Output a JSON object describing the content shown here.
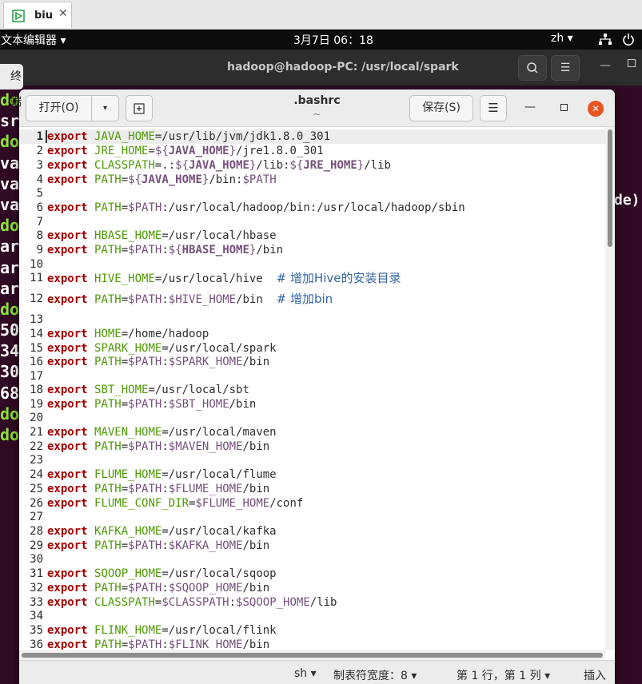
{
  "browser_tab": {
    "label": "biu",
    "close": "✕"
  },
  "topbar": {
    "app": "文本编辑器 ▾",
    "clock": "3月7日 06：18",
    "lang": "zh ▾"
  },
  "terminal": {
    "title": "hadoop@hadoop-PC: /usr/local/spark",
    "tab_fragment": "终端",
    "visible_fragments": [
      {
        "text": "do",
        "color": "green"
      },
      {
        "text": "sr",
        "color": "white"
      },
      {
        "text": "do",
        "color": "green"
      },
      {
        "text": "va",
        "color": "white"
      },
      {
        "text": "va",
        "color": "white"
      },
      {
        "text": "va",
        "color": "white"
      },
      {
        "text": "do",
        "color": "green"
      },
      {
        "text": "ar",
        "color": "white"
      },
      {
        "text": "ar",
        "color": "white"
      },
      {
        "text": "ar",
        "color": "white"
      },
      {
        "text": "do",
        "color": "green"
      },
      {
        "text": "50",
        "color": "white"
      },
      {
        "text": "34",
        "color": "white"
      },
      {
        "text": "30",
        "color": "white"
      },
      {
        "text": "68",
        "color": "white"
      },
      {
        "text": "do",
        "color": "green"
      },
      {
        "text": "do",
        "color": "green"
      }
    ],
    "right_fragment": "de)"
  },
  "gedit": {
    "open_label": "打开(O)",
    "open_arrow": "▾",
    "newtab_label": "⊞",
    "title": ".bashrc",
    "subtitle": "~",
    "save_label": "保存(S)",
    "menu_label": "☰",
    "min_label": "—",
    "close_label": "✕",
    "current_line": 1,
    "lines": [
      [
        {
          "c": "kw",
          "t": "export"
        },
        {
          "c": "p",
          "t": " "
        },
        {
          "c": "var",
          "t": "JAVA_HOME"
        },
        {
          "c": "p",
          "t": "=/usr/lib/jvm/jdk1.8.0_301"
        }
      ],
      [
        {
          "c": "kw",
          "t": "export"
        },
        {
          "c": "p",
          "t": " "
        },
        {
          "c": "var",
          "t": "JRE_HOME"
        },
        {
          "c": "p",
          "t": "="
        },
        {
          "c": "dollar",
          "t": "${"
        },
        {
          "c": "sub",
          "t": "JAVA_HOME"
        },
        {
          "c": "dollar",
          "t": "}"
        },
        {
          "c": "p",
          "t": "/jre1.8.0_301"
        }
      ],
      [
        {
          "c": "kw",
          "t": "export"
        },
        {
          "c": "p",
          "t": " "
        },
        {
          "c": "var",
          "t": "CLASSPATH"
        },
        {
          "c": "p",
          "t": "=.:"
        },
        {
          "c": "dollar",
          "t": "${"
        },
        {
          "c": "sub",
          "t": "JAVA_HOME"
        },
        {
          "c": "dollar",
          "t": "}"
        },
        {
          "c": "p",
          "t": "/lib:"
        },
        {
          "c": "dollar",
          "t": "${"
        },
        {
          "c": "sub",
          "t": "JRE_HOME"
        },
        {
          "c": "dollar",
          "t": "}"
        },
        {
          "c": "p",
          "t": "/lib"
        }
      ],
      [
        {
          "c": "kw",
          "t": "export"
        },
        {
          "c": "p",
          "t": " "
        },
        {
          "c": "var",
          "t": "PATH"
        },
        {
          "c": "p",
          "t": "="
        },
        {
          "c": "dollar",
          "t": "${"
        },
        {
          "c": "sub",
          "t": "JAVA_HOME"
        },
        {
          "c": "dollar",
          "t": "}"
        },
        {
          "c": "p",
          "t": "/bin:"
        },
        {
          "c": "dollar",
          "t": "$PATH"
        }
      ],
      [],
      [
        {
          "c": "kw",
          "t": "export"
        },
        {
          "c": "p",
          "t": " "
        },
        {
          "c": "var",
          "t": "PATH"
        },
        {
          "c": "p",
          "t": "="
        },
        {
          "c": "dollar",
          "t": "$PATH"
        },
        {
          "c": "p",
          "t": ":/usr/local/hadoop/bin:/usr/local/hadoop/sbin"
        }
      ],
      [],
      [
        {
          "c": "kw",
          "t": "export"
        },
        {
          "c": "p",
          "t": " "
        },
        {
          "c": "var",
          "t": "HBASE_HOME"
        },
        {
          "c": "p",
          "t": "=/usr/local/hbase"
        }
      ],
      [
        {
          "c": "kw",
          "t": "export"
        },
        {
          "c": "p",
          "t": " "
        },
        {
          "c": "var",
          "t": "PATH"
        },
        {
          "c": "p",
          "t": "="
        },
        {
          "c": "dollar",
          "t": "$PATH"
        },
        {
          "c": "p",
          "t": ":"
        },
        {
          "c": "dollar",
          "t": "${"
        },
        {
          "c": "sub",
          "t": "HBASE_HOME"
        },
        {
          "c": "dollar",
          "t": "}"
        },
        {
          "c": "p",
          "t": "/bin"
        }
      ],
      [],
      [
        {
          "c": "kw",
          "t": "export"
        },
        {
          "c": "p",
          "t": " "
        },
        {
          "c": "var",
          "t": "HIVE_HOME"
        },
        {
          "c": "p",
          "t": "=/usr/local/hive  "
        },
        {
          "c": "cmt",
          "t": "# 增加Hive的安装目录"
        }
      ],
      [
        {
          "c": "kw",
          "t": "export"
        },
        {
          "c": "p",
          "t": " "
        },
        {
          "c": "var",
          "t": "PATH"
        },
        {
          "c": "p",
          "t": "="
        },
        {
          "c": "dollar",
          "t": "$PATH"
        },
        {
          "c": "p",
          "t": ":"
        },
        {
          "c": "dollar",
          "t": "$HIVE_HOME"
        },
        {
          "c": "p",
          "t": "/bin  "
        },
        {
          "c": "cmt",
          "t": "# 增加bin"
        }
      ],
      [],
      [
        {
          "c": "kw",
          "t": "export"
        },
        {
          "c": "p",
          "t": " "
        },
        {
          "c": "var",
          "t": "HOME"
        },
        {
          "c": "p",
          "t": "=/home/hadoop"
        }
      ],
      [
        {
          "c": "kw",
          "t": "export"
        },
        {
          "c": "p",
          "t": " "
        },
        {
          "c": "var",
          "t": "SPARK_HOME"
        },
        {
          "c": "p",
          "t": "=/usr/local/spark"
        }
      ],
      [
        {
          "c": "kw",
          "t": "export"
        },
        {
          "c": "p",
          "t": " "
        },
        {
          "c": "var",
          "t": "PATH"
        },
        {
          "c": "p",
          "t": "="
        },
        {
          "c": "dollar",
          "t": "$PATH"
        },
        {
          "c": "p",
          "t": ":"
        },
        {
          "c": "dollar",
          "t": "$SPARK_HOME"
        },
        {
          "c": "p",
          "t": "/bin"
        }
      ],
      [],
      [
        {
          "c": "kw",
          "t": "export"
        },
        {
          "c": "p",
          "t": " "
        },
        {
          "c": "var",
          "t": "SBT_HOME"
        },
        {
          "c": "p",
          "t": "=/usr/local/sbt"
        }
      ],
      [
        {
          "c": "kw",
          "t": "export"
        },
        {
          "c": "p",
          "t": " "
        },
        {
          "c": "var",
          "t": "PATH"
        },
        {
          "c": "p",
          "t": "="
        },
        {
          "c": "dollar",
          "t": "$PATH"
        },
        {
          "c": "p",
          "t": ":"
        },
        {
          "c": "dollar",
          "t": "$SBT_HOME"
        },
        {
          "c": "p",
          "t": "/bin"
        }
      ],
      [],
      [
        {
          "c": "kw",
          "t": "export"
        },
        {
          "c": "p",
          "t": " "
        },
        {
          "c": "var",
          "t": "MAVEN_HOME"
        },
        {
          "c": "p",
          "t": "=/usr/local/maven"
        }
      ],
      [
        {
          "c": "kw",
          "t": "export"
        },
        {
          "c": "p",
          "t": " "
        },
        {
          "c": "var",
          "t": "PATH"
        },
        {
          "c": "p",
          "t": "="
        },
        {
          "c": "dollar",
          "t": "$PATH"
        },
        {
          "c": "p",
          "t": ":"
        },
        {
          "c": "dollar",
          "t": "$MAVEN_HOME"
        },
        {
          "c": "p",
          "t": "/bin"
        }
      ],
      [],
      [
        {
          "c": "kw",
          "t": "export"
        },
        {
          "c": "p",
          "t": " "
        },
        {
          "c": "var",
          "t": "FLUME_HOME"
        },
        {
          "c": "p",
          "t": "=/usr/local/flume"
        }
      ],
      [
        {
          "c": "kw",
          "t": "export"
        },
        {
          "c": "p",
          "t": " "
        },
        {
          "c": "var",
          "t": "PATH"
        },
        {
          "c": "p",
          "t": "="
        },
        {
          "c": "dollar",
          "t": "$PATH"
        },
        {
          "c": "p",
          "t": ":"
        },
        {
          "c": "dollar",
          "t": "$FLUME_HOME"
        },
        {
          "c": "p",
          "t": "/bin"
        }
      ],
      [
        {
          "c": "kw",
          "t": "export"
        },
        {
          "c": "p",
          "t": " "
        },
        {
          "c": "var",
          "t": "FLUME_CONF_DIR"
        },
        {
          "c": "p",
          "t": "="
        },
        {
          "c": "dollar",
          "t": "$FLUME_HOME"
        },
        {
          "c": "p",
          "t": "/conf"
        }
      ],
      [],
      [
        {
          "c": "kw",
          "t": "export"
        },
        {
          "c": "p",
          "t": " "
        },
        {
          "c": "var",
          "t": "KAFKA_HOME"
        },
        {
          "c": "p",
          "t": "=/usr/local/kafka"
        }
      ],
      [
        {
          "c": "kw",
          "t": "export"
        },
        {
          "c": "p",
          "t": " "
        },
        {
          "c": "var",
          "t": "PATH"
        },
        {
          "c": "p",
          "t": "="
        },
        {
          "c": "dollar",
          "t": "$PATH"
        },
        {
          "c": "p",
          "t": ":"
        },
        {
          "c": "dollar",
          "t": "$KAFKA_HOME"
        },
        {
          "c": "p",
          "t": "/bin"
        }
      ],
      [],
      [
        {
          "c": "kw",
          "t": "export"
        },
        {
          "c": "p",
          "t": " "
        },
        {
          "c": "var",
          "t": "SQOOP_HOME"
        },
        {
          "c": "p",
          "t": "=/usr/local/sqoop"
        }
      ],
      [
        {
          "c": "kw",
          "t": "export"
        },
        {
          "c": "p",
          "t": " "
        },
        {
          "c": "var",
          "t": "PATH"
        },
        {
          "c": "p",
          "t": "="
        },
        {
          "c": "dollar",
          "t": "$PATH"
        },
        {
          "c": "p",
          "t": ":"
        },
        {
          "c": "dollar",
          "t": "$SQOOP_HOME"
        },
        {
          "c": "p",
          "t": "/bin"
        }
      ],
      [
        {
          "c": "kw",
          "t": "export"
        },
        {
          "c": "p",
          "t": " "
        },
        {
          "c": "var",
          "t": "CLASSPATH"
        },
        {
          "c": "p",
          "t": "="
        },
        {
          "c": "dollar",
          "t": "$CLASSPATH"
        },
        {
          "c": "p",
          "t": ":"
        },
        {
          "c": "dollar",
          "t": "$SQOOP_HOME"
        },
        {
          "c": "p",
          "t": "/lib"
        }
      ],
      [],
      [
        {
          "c": "kw",
          "t": "export"
        },
        {
          "c": "p",
          "t": " "
        },
        {
          "c": "var",
          "t": "FLINK_HOME"
        },
        {
          "c": "p",
          "t": "=/usr/local/flink"
        }
      ],
      [
        {
          "c": "kw",
          "t": "export"
        },
        {
          "c": "p",
          "t": " "
        },
        {
          "c": "var",
          "t": "PATH"
        },
        {
          "c": "p",
          "t": "="
        },
        {
          "c": "dollar",
          "t": "$PATH"
        },
        {
          "c": "p",
          "t": ":"
        },
        {
          "c": "dollar",
          "t": "$FLINK_HOME"
        },
        {
          "c": "p",
          "t": "/bin"
        }
      ]
    ],
    "status": {
      "lang": "sh ▾",
      "tab_width": "制表符宽度：8 ▾",
      "position": "第 1 行，第 1 列 ▾",
      "mode": "插入"
    }
  },
  "colors": {
    "terminal_bg": "#300a24",
    "keyword": "#a40000",
    "variable": "#4e9a06",
    "substitution": "#75507b",
    "comment": "#3465a4",
    "close_button": "#e95420"
  }
}
